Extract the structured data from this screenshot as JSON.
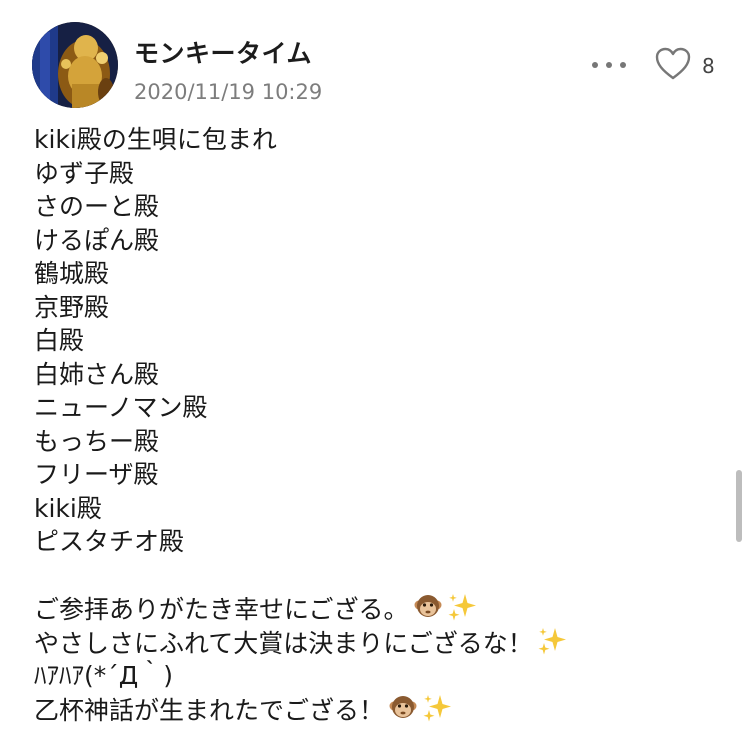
{
  "post": {
    "author": "モンキータイム",
    "timestamp": "2020/11/19 10:29",
    "like_count": "8",
    "lines": [
      "kiki殿の生唄に包まれ",
      "ゆず子殿",
      "さのーと殿",
      "けるぽん殿",
      "鶴城殿",
      "京野殿",
      "白殿",
      "白姉さん殿",
      "ニューノマン殿",
      "もっちー殿",
      "フリーザ殿",
      "kiki殿",
      "ピスタチオ殿",
      "",
      "ご参拝ありがたき幸せにござる。",
      "やさしさにふれて大賞は決まりにござるな！",
      "ﾊｱﾊｱ(*´Д｀)",
      "乙杯神話が生まれたでござる！"
    ]
  },
  "icons": {
    "more": "more-horizontal-icon",
    "like": "heart-outline-icon",
    "emoji_monkey": "monkey-emoji",
    "emoji_sparkles": "sparkles-emoji"
  },
  "colors": {
    "timestamp": "#7d7d7d",
    "icon": "#777777"
  }
}
